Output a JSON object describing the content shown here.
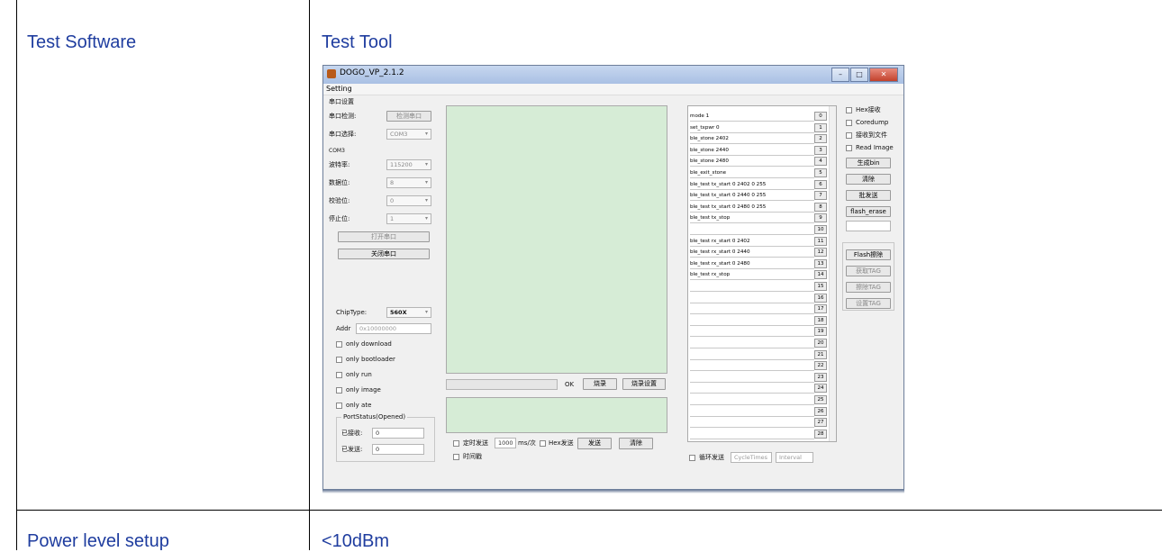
{
  "table": {
    "row1": {
      "label": "Test Software",
      "value": "Test Tool"
    },
    "row2": {
      "label": "Power level setup",
      "value": "<10dBm"
    }
  },
  "app": {
    "window_title": "DOGO_VP_2.1.2",
    "menu": "Setting",
    "serial": {
      "group_title": "串口设置",
      "detect_label": "串口检测:",
      "detect_button": "检测串口",
      "select_label": "串口选择:",
      "select_value": "COM3",
      "port_name": "COM3",
      "baud_label": "波特率:",
      "baud_value": "115200",
      "databits_label": "数据位:",
      "databits_value": "8",
      "parity_label": "校验位:",
      "parity_value": "0",
      "stopbits_label": "停止位:",
      "stopbits_value": "1",
      "open_button": "打开串口",
      "close_button": "关闭串口"
    },
    "chip": {
      "type_label": "ChipType:",
      "type_value": "560X",
      "addr_label": "Addr",
      "addr_value": "0x10000000"
    },
    "options": [
      "only download",
      "only bootloader",
      "only run",
      "only image",
      "only ate"
    ],
    "port_status": {
      "title": "PortStatus(Opened)",
      "received_label": "已接收:",
      "received_value": "0",
      "sent_label": "已发送:",
      "sent_value": "0"
    },
    "progress_ok": "OK",
    "burn_button": "烧录",
    "burn_settings_button": "烧录设置",
    "timed_send_label": "定时发送",
    "interval_value": "1000",
    "interval_unit": "ms/次",
    "hex_send_label": "Hex发送",
    "send_button": "发送",
    "clear_button": "清除",
    "timestamp_label": "时间戳",
    "commands": [
      {
        "text": "mode 1",
        "num": "0"
      },
      {
        "text": "set_txpwr 0",
        "num": "1"
      },
      {
        "text": "ble_stone 2402",
        "num": "2"
      },
      {
        "text": "ble_stone 2440",
        "num": "3"
      },
      {
        "text": "ble_stone 2480",
        "num": "4"
      },
      {
        "text": "ble_exit_stone",
        "num": "5"
      },
      {
        "text": "ble_test tx_start 0 2402 0 255",
        "num": "6"
      },
      {
        "text": "ble_test tx_start 0 2440 0 255",
        "num": "7"
      },
      {
        "text": "ble_test tx_start 0 2480 0 255",
        "num": "8"
      },
      {
        "text": "ble_test tx_stop",
        "num": "9"
      },
      {
        "text": "",
        "num": "10"
      },
      {
        "text": "ble_test rx_start 0 2402",
        "num": "11"
      },
      {
        "text": "ble_test rx_start 0 2440",
        "num": "12"
      },
      {
        "text": "ble_test rx_start 0 2480",
        "num": "13"
      },
      {
        "text": "ble_test rx_stop",
        "num": "14"
      },
      {
        "text": "",
        "num": "15"
      },
      {
        "text": "",
        "num": "16"
      },
      {
        "text": "",
        "num": "17"
      },
      {
        "text": "",
        "num": "18"
      },
      {
        "text": "",
        "num": "19"
      },
      {
        "text": "",
        "num": "20"
      },
      {
        "text": "",
        "num": "21"
      },
      {
        "text": "",
        "num": "22"
      },
      {
        "text": "",
        "num": "23"
      },
      {
        "text": "",
        "num": "24"
      },
      {
        "text": "",
        "num": "25"
      },
      {
        "text": "",
        "num": "26"
      },
      {
        "text": "",
        "num": "27"
      },
      {
        "text": "",
        "num": "28"
      }
    ],
    "loop_send_label": "循环发送",
    "cycle_times_placeholder": "CycleTimes",
    "interval_placeholder": "Interval",
    "right": {
      "hex_receive": "Hex接收",
      "coredump": "Coredump",
      "save_to_file": "接收到文件",
      "read_image": "Read Image",
      "gen_bin": "生成bin",
      "clear": "清除",
      "batch_send": "批发送",
      "flash_erase_btn": "flash_erase",
      "flash_clear": "Flash擦除",
      "get_tag": "获取TAG",
      "erase_tag": "擦除TAG",
      "set_tag": "设置TAG"
    }
  }
}
